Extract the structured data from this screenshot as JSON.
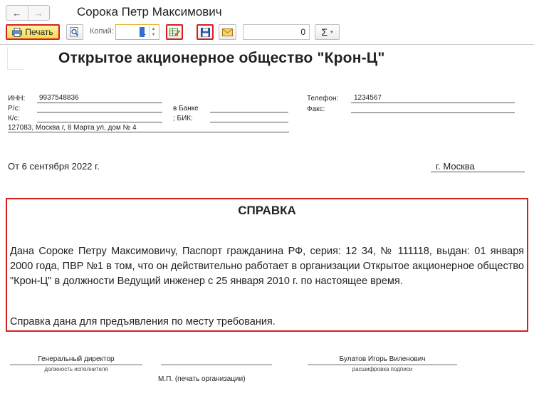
{
  "window": {
    "title": "Сорока Петр Максимович",
    "back_icon": "←",
    "forward_icon": "→"
  },
  "toolbar": {
    "print_label": "Печать",
    "copies_label": "Копий:",
    "copies_value": "1",
    "sum_value": "0",
    "sigma_label": "Σ",
    "caret": "▾"
  },
  "document": {
    "org_name": "Открытое акционерное общество \"Крон-Ц\"",
    "inn_label": "ИНН:",
    "inn_value": "9937548836",
    "rs_label": "Р/с:",
    "bank_label": "в Банке",
    "ks_label": "К/с:",
    "bik_label": "; БИК:",
    "address": "127083, Москва г, 8 Марта ул, дом № 4",
    "phone_label": "Телефон:",
    "phone_value": "1234567",
    "fax_label": "Факс:",
    "date_text": "От 6 сентября 2022 г.",
    "city_text": "г. Москва"
  },
  "certificate": {
    "title": "СПРАВКА",
    "body": "Дана Сороке Петру Максимовичу, Паспорт гражданина РФ, серия: 12 34, № 111118, выдан: 01 января 2000 года, ПВР №1 в том, что он действительно работает в организации Открытое акционерное общество \"Крон-Ц\" в должности Ведущий инженер с 25 января 2010 г. по настоящее время.",
    "purpose": "Справка дана для предъявления по месту требования."
  },
  "signatures": {
    "role": "Генеральный директор",
    "role_caption": "должность исполнителя",
    "name": "Булатов Игорь Виленович",
    "name_caption": "расшифровка подписи",
    "stamp": "М.П. (печать организации)"
  },
  "colors": {
    "highlight_frame": "#d32020",
    "print_button": "#f4d94a",
    "copies_focus": "#e2b52c"
  }
}
